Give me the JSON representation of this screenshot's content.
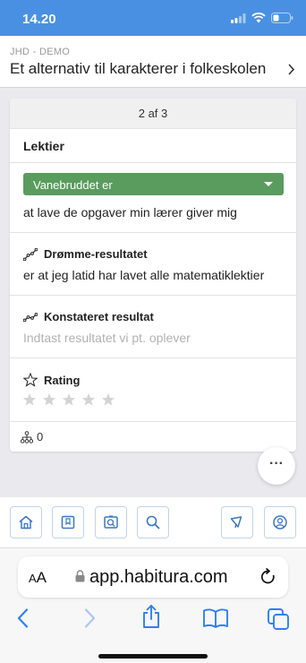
{
  "status_bar": {
    "time": "14.20"
  },
  "header": {
    "subtitle": "JHD - DEMO",
    "title": "Et alternativ til karakterer i folkeskolen"
  },
  "card": {
    "pager": "2 af 3",
    "section_title": "Lektier",
    "habit_break": {
      "dropdown_label": "Vanebruddet er",
      "value": "at lave de opgaver min lærer giver mig"
    },
    "dream_result": {
      "label": "Drømme-resultatet",
      "value": "er at jeg latid har lavet alle matematiklektier"
    },
    "observed_result": {
      "label": "Konstateret resultat",
      "placeholder": "Indtast resultatet vi pt. oplever"
    },
    "rating": {
      "label": "Rating",
      "stars_total": 5,
      "stars_filled": 0
    },
    "children_count": "0"
  },
  "fab": {
    "label": "···"
  },
  "bottom_nav": {
    "items": [
      "home-icon",
      "bookmark-icon",
      "photo-search-icon",
      "search-icon",
      "megaphone-icon",
      "user-icon"
    ]
  },
  "safari": {
    "aa_small": "A",
    "aa_large": "A",
    "url": "app.habitura.com"
  },
  "colors": {
    "status_bar": "#4a90e2",
    "dropdown": "#5a9b5e",
    "nav_icon": "#3a78c4"
  }
}
